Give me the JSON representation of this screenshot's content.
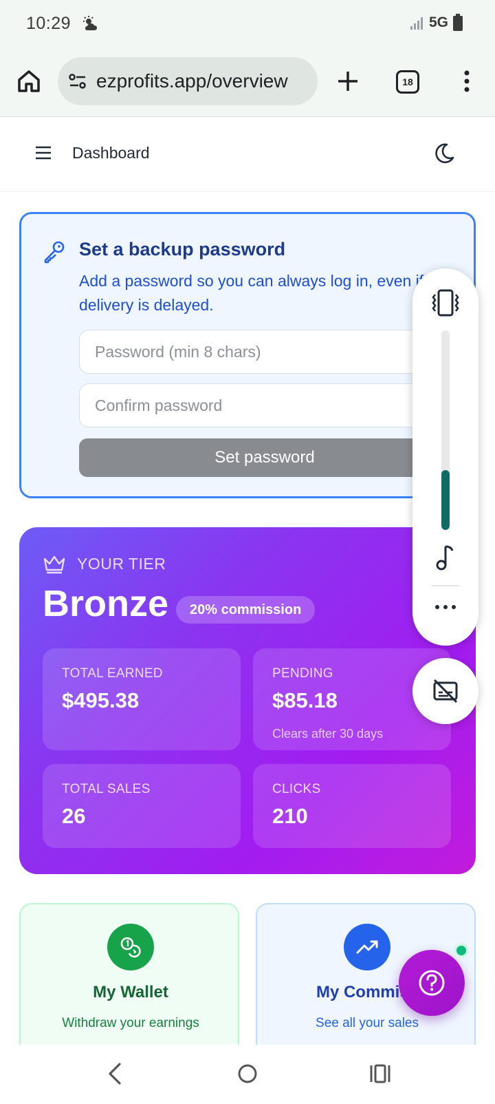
{
  "status_bar": {
    "time": "10:29",
    "network": "5G",
    "weather_icon": "partly-cloudy-icon",
    "signal_icon": "signal-icon",
    "battery_icon": "battery-icon"
  },
  "browser": {
    "url": "ezprofits.app/overview",
    "tab_count": "18"
  },
  "header": {
    "title": "Dashboard"
  },
  "backup": {
    "title": "Set a backup password",
    "description": "Add a password so you can always log in, even if email delivery is delayed.",
    "password_placeholder": "Password (min 8 chars)",
    "confirm_placeholder": "Confirm password",
    "submit_label": "Set password"
  },
  "tier": {
    "label": "YOUR TIER",
    "name": "Bronze",
    "commission_badge": "20% commission",
    "stats": [
      {
        "label": "TOTAL EARNED",
        "value": "$495.38",
        "sub": ""
      },
      {
        "label": "PENDING",
        "value": "$85.18",
        "sub": "Clears after 30 days"
      },
      {
        "label": "TOTAL SALES",
        "value": "26",
        "sub": ""
      },
      {
        "label": "CLICKS",
        "value": "210",
        "sub": ""
      }
    ]
  },
  "quick_links": [
    {
      "title": "My Wallet",
      "subtitle": "Withdraw your earnings"
    },
    {
      "title": "My Commiss",
      "subtitle": "See all your sales"
    }
  ],
  "volume": {
    "level": 0.3
  },
  "colors": {
    "accent_blue": "#3b82f6",
    "tier_gradient_start": "#6d5cf6",
    "tier_gradient_end": "#c21bdc",
    "wallet_green": "#16a34a",
    "commission_blue": "#2563eb",
    "help_fab": "#a21caf"
  }
}
